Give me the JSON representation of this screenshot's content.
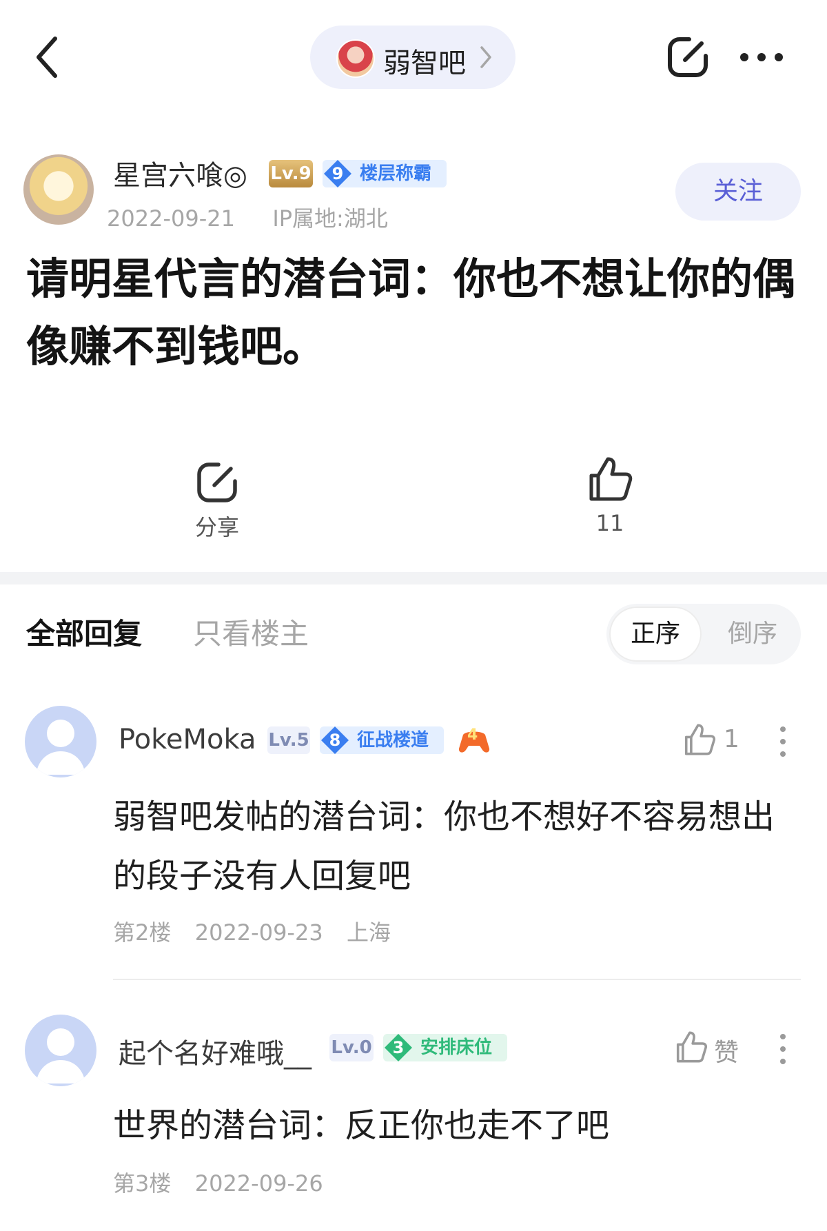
{
  "top_bar": {
    "forum_name": "弱智吧"
  },
  "post": {
    "author_name": "星宫六喰◎",
    "author_level": "Lv.9",
    "author_honor_rank": "9",
    "author_honor_title": "楼层称霸",
    "date": "2022-09-21",
    "ip_location": "IP属地:湖北",
    "follow_label": "关注",
    "title": "请明星代言的潜台词：你也不想让你的偶像赚不到钱吧。",
    "share_label": "分享",
    "like_count": "11"
  },
  "replies_header": {
    "tab_all": "全部回复",
    "tab_op_only": "只看楼主",
    "sort_asc": "正序",
    "sort_desc": "倒序"
  },
  "comments": [
    {
      "username": "PokeMoka",
      "level": "Lv.5",
      "honor_rank": "8",
      "honor_title": "征战楼道",
      "honor_color": "#3a7ef0",
      "extra_badge": "4",
      "like_label": "1",
      "body": "弱智吧发帖的潜台词：你也不想好不容易想出的段子没有人回复吧",
      "floor": "第2楼",
      "date": "2022-09-23",
      "location": "上海"
    },
    {
      "username": "起个名好难哦__",
      "level": "Lv.0",
      "honor_rank": "3",
      "honor_title": "安排床位",
      "honor_color": "#2fba7a",
      "like_label": "赞",
      "body": "世界的潜台词：反正你也走不了吧",
      "floor": "第3楼",
      "date": "2022-09-26",
      "location": ""
    }
  ]
}
